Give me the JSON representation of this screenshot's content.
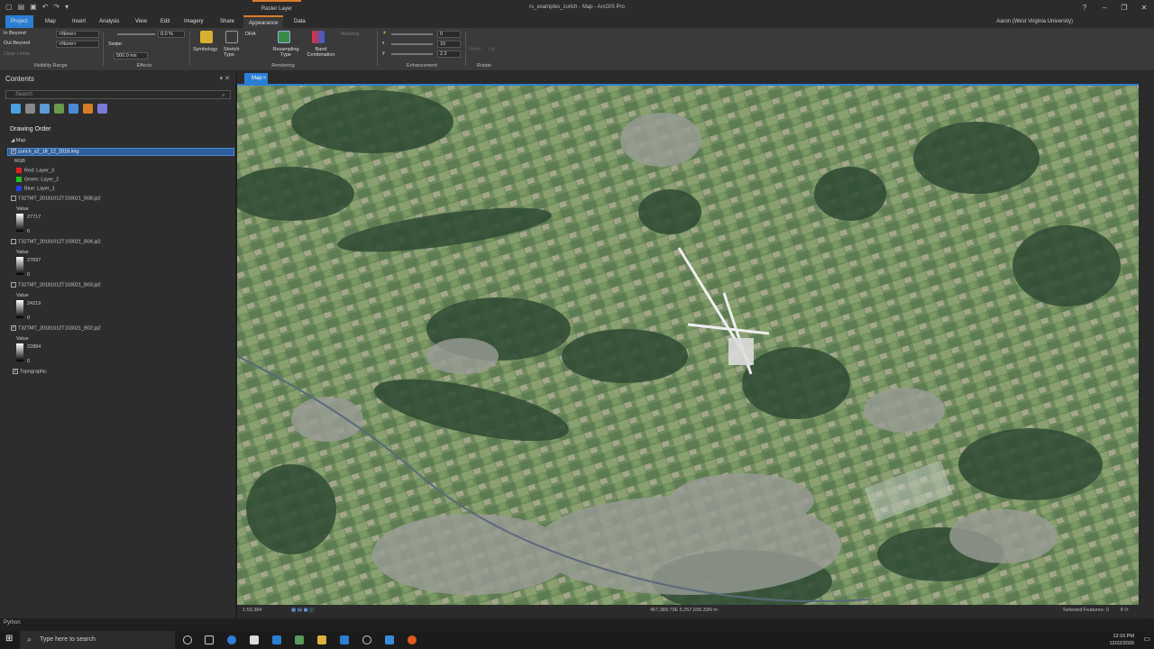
{
  "window": {
    "context_tab": "Raster Layer",
    "title": "rs_examples_zurich - Map - ArcGIS Pro",
    "user": "Aaron (West Virginia University)"
  },
  "ribbon_tabs": [
    "Project",
    "Map",
    "Insert",
    "Analysis",
    "View",
    "Edit",
    "Imagery",
    "Share",
    "Appearance",
    "Data"
  ],
  "ribbon": {
    "visibility": {
      "in_beyond": "In Beyond",
      "out_beyond": "Out Beyond",
      "clear_limits": "Clear Limits",
      "in_value": "<None>",
      "out_value": "<None>",
      "label": "Visibility Range"
    },
    "effects": {
      "transparency": "0.0 %",
      "swipe": "Swipe",
      "flicker": "500.0 ms",
      "label": "Effects"
    },
    "symbology": "Symbology",
    "stretch": "Stretch Type",
    "dra": "DRA",
    "resampling": "Resampling Type",
    "band_combination": "Band Combination",
    "rendering_label": "Rendering",
    "masking": "Masking",
    "enhancement": {
      "brightness": "0",
      "contrast": "10",
      "gamma": "2.2",
      "label": "Enhancement"
    },
    "rotate": {
      "north": "North",
      "up": "Up",
      "label": "Rotate"
    }
  },
  "contents": {
    "title": "Contents",
    "search_placeholder": "Search",
    "drawing_order": "Drawing Order",
    "map_node": "Map",
    "selected_layer": "zurich_s2_18_12_2018.img",
    "rgb_label": "RGB",
    "bands": [
      {
        "label": "Red:  Layer_3",
        "color": "#e02020"
      },
      {
        "label": "Green: Layer_2",
        "color": "#20c020"
      },
      {
        "label": "Blue:  Layer_1",
        "color": "#2040e0"
      }
    ],
    "layers": [
      {
        "name": "T32TMT_20181012T103021_B08.jp2",
        "value_label": "Value",
        "max": "27717",
        "min": "0",
        "checked": false
      },
      {
        "name": "T32TMT_20181012T103021_B04.jp2",
        "value_label": "Value",
        "max": "27697",
        "min": "0",
        "checked": false
      },
      {
        "name": "T32TMT_20181012T103021_B03.jp2",
        "value_label": "Value",
        "max": "24219",
        "min": "0",
        "checked": false
      },
      {
        "name": "T32TMT_20181012T103021_B02.jp2",
        "value_label": "Value",
        "max": "22884",
        "min": "0",
        "checked": true
      }
    ],
    "basemap": "Topographic"
  },
  "map_view": {
    "tab": "Map",
    "scale": "1:59,384",
    "coordinates": "457,389.79E 5,257,695.33N m",
    "selected_features": "Selected Features: 0"
  },
  "python_tab": "Python",
  "taskbar": {
    "search_placeholder": "Type here to search",
    "time": "12:16 PM",
    "date": "12/22/2020"
  }
}
